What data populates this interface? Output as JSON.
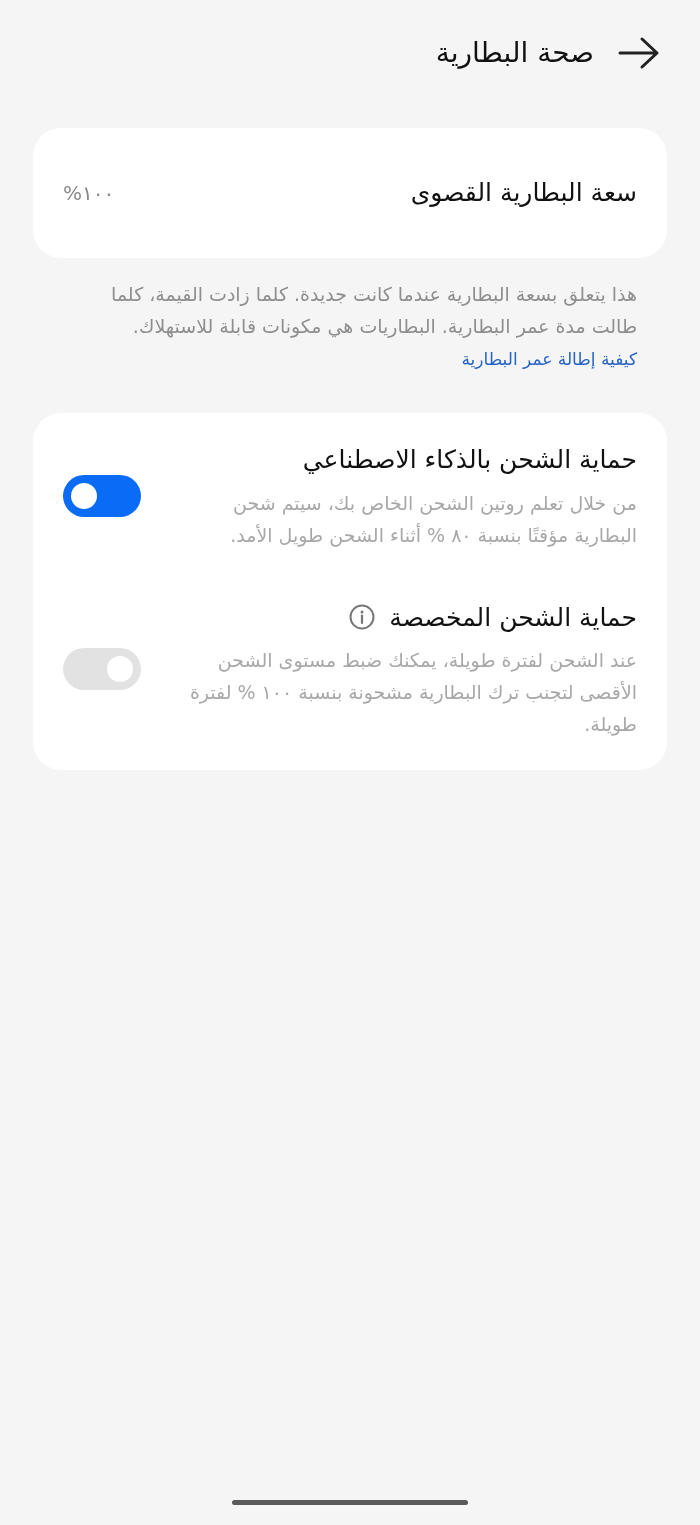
{
  "header": {
    "title": "صحة البطارية"
  },
  "capacity_card": {
    "label": "سعة البطارية القصوى",
    "value": "١٠٠%"
  },
  "capacity_note": {
    "text": "هذا يتعلق بسعة البطارية عندما كانت جديدة. كلما زادت القيمة، كلما طالت مدة عمر البطارية. البطاريات هي مكونات قابلة للاستهلاك.",
    "link": "كيفية إطالة عمر البطارية"
  },
  "settings": [
    {
      "title": "حماية الشحن بالذكاء الاصطناعي",
      "info": false,
      "description": "من خلال تعلم روتين الشحن الخاص بك، سيتم شحن البطارية مؤقتًا بنسبة ٨٠ % أثناء الشحن طويل الأمد.",
      "on": true
    },
    {
      "title": "حماية الشحن المخصصة",
      "info": true,
      "description": "عند الشحن لفترة طويلة، يمكنك ضبط مستوى الشحن الأقصى لتجنب ترك البطارية مشحونة بنسبة ١٠٠ % لفترة طويلة.",
      "on": false
    }
  ]
}
